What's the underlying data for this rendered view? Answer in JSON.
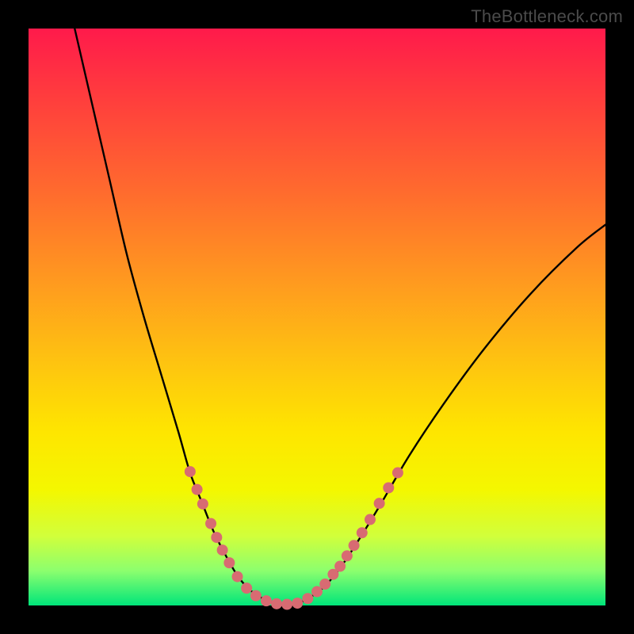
{
  "watermark": "TheBottleneck.com",
  "colors": {
    "frame": "#000000",
    "line": "#000000",
    "marker": "#d86b72",
    "gradient_stops": [
      {
        "pos": 0.0,
        "hex": "#ff1a4b"
      },
      {
        "pos": 0.12,
        "hex": "#ff3d3d"
      },
      {
        "pos": 0.28,
        "hex": "#ff6a2e"
      },
      {
        "pos": 0.44,
        "hex": "#ff9a1f"
      },
      {
        "pos": 0.58,
        "hex": "#fec410"
      },
      {
        "pos": 0.7,
        "hex": "#fee600"
      },
      {
        "pos": 0.8,
        "hex": "#f4f700"
      },
      {
        "pos": 0.88,
        "hex": "#d1ff3b"
      },
      {
        "pos": 0.94,
        "hex": "#8cff6e"
      },
      {
        "pos": 1.0,
        "hex": "#00e57a"
      }
    ]
  },
  "chart_data": {
    "type": "line",
    "title": "",
    "xlabel": "",
    "ylabel": "",
    "xlim": [
      0,
      1
    ],
    "ylim": [
      0,
      1
    ],
    "series": [
      {
        "name": "curve-left",
        "x": [
          0.08,
          0.11,
          0.14,
          0.17,
          0.2,
          0.23,
          0.26,
          0.28,
          0.3,
          0.32,
          0.34,
          0.36,
          0.38,
          0.4
        ],
        "y": [
          1.0,
          0.87,
          0.74,
          0.61,
          0.5,
          0.4,
          0.3,
          0.23,
          0.18,
          0.13,
          0.09,
          0.055,
          0.03,
          0.015
        ]
      },
      {
        "name": "curve-bottom",
        "x": [
          0.4,
          0.42,
          0.44,
          0.462,
          0.48
        ],
        "y": [
          0.015,
          0.006,
          0.002,
          0.003,
          0.009
        ]
      },
      {
        "name": "curve-right",
        "x": [
          0.48,
          0.51,
          0.54,
          0.57,
          0.61,
          0.66,
          0.72,
          0.79,
          0.87,
          0.95,
          1.0
        ],
        "y": [
          0.009,
          0.03,
          0.065,
          0.11,
          0.175,
          0.26,
          0.35,
          0.445,
          0.54,
          0.62,
          0.66
        ]
      }
    ],
    "markers": {
      "name": "highlighted-points",
      "color": "#d86b72",
      "radius_px": 7,
      "points": [
        {
          "x": 0.28,
          "y": 0.232
        },
        {
          "x": 0.292,
          "y": 0.201
        },
        {
          "x": 0.302,
          "y": 0.176
        },
        {
          "x": 0.316,
          "y": 0.142
        },
        {
          "x": 0.326,
          "y": 0.118
        },
        {
          "x": 0.336,
          "y": 0.096
        },
        {
          "x": 0.348,
          "y": 0.074
        },
        {
          "x": 0.362,
          "y": 0.05
        },
        {
          "x": 0.378,
          "y": 0.03
        },
        {
          "x": 0.394,
          "y": 0.017
        },
        {
          "x": 0.412,
          "y": 0.008
        },
        {
          "x": 0.43,
          "y": 0.003
        },
        {
          "x": 0.448,
          "y": 0.002
        },
        {
          "x": 0.466,
          "y": 0.004
        },
        {
          "x": 0.484,
          "y": 0.012
        },
        {
          "x": 0.5,
          "y": 0.024
        },
        {
          "x": 0.514,
          "y": 0.037
        },
        {
          "x": 0.528,
          "y": 0.054
        },
        {
          "x": 0.54,
          "y": 0.068
        },
        {
          "x": 0.552,
          "y": 0.086
        },
        {
          "x": 0.564,
          "y": 0.104
        },
        {
          "x": 0.578,
          "y": 0.126
        },
        {
          "x": 0.592,
          "y": 0.149
        },
        {
          "x": 0.608,
          "y": 0.177
        },
        {
          "x": 0.624,
          "y": 0.204
        },
        {
          "x": 0.64,
          "y": 0.23
        }
      ]
    }
  }
}
